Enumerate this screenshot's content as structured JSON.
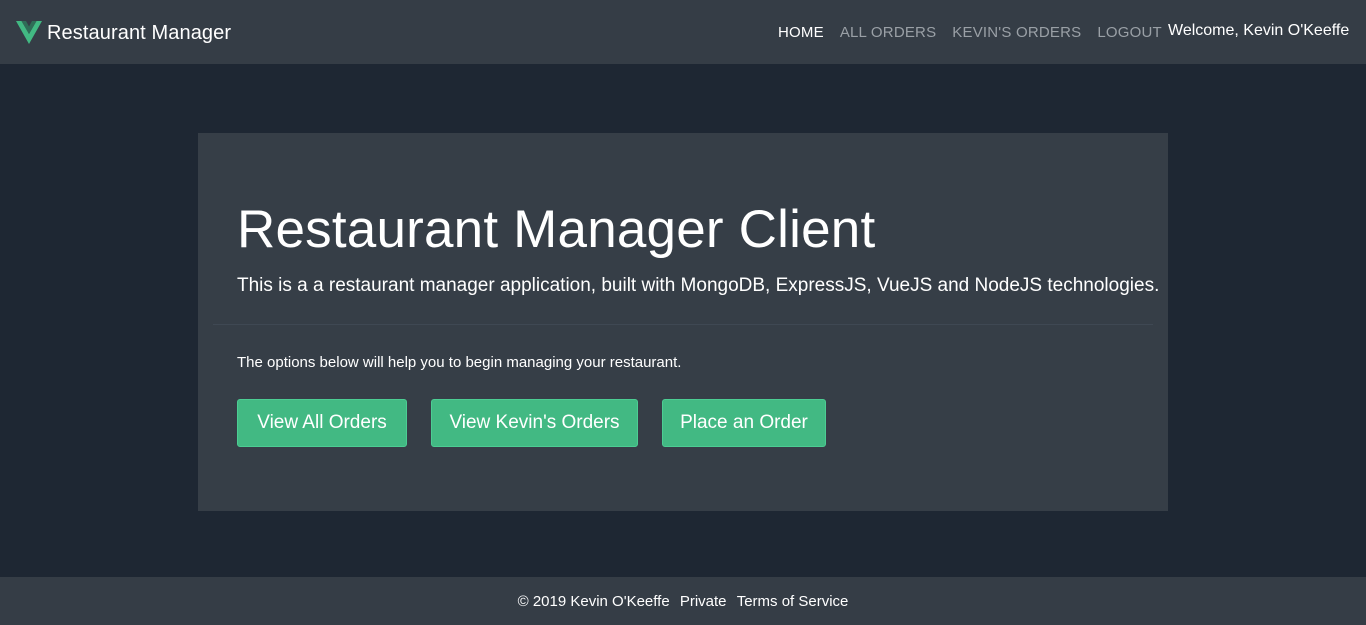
{
  "navbar": {
    "brand_logo_icon": "vue-logo-icon",
    "brand_label": "Restaurant Manager",
    "links": [
      {
        "label": "HOME",
        "active": true
      },
      {
        "label": "ALL ORDERS",
        "active": false
      },
      {
        "label": "KEVIN'S ORDERS",
        "active": false
      },
      {
        "label": "LOGOUT",
        "active": false
      }
    ],
    "welcome": "Welcome, Kevin O'Keeffe"
  },
  "main": {
    "title": "Restaurant Manager Client",
    "lead": "This is a a restaurant manager application, built with MongoDB, ExpressJS, VueJS and NodeJS technologies.",
    "intro": "The options below will help you to begin managing your restaurant.",
    "buttons": [
      {
        "label": "View All Orders"
      },
      {
        "label": "View Kevin's Orders"
      },
      {
        "label": "Place an Order"
      }
    ]
  },
  "footer": {
    "copyright": "© 2019 Kevin O'Keeffe",
    "private_label": "Private",
    "terms_label": "Terms of Service"
  },
  "colors": {
    "navbar_bg": "#353d46",
    "page_bg": "#1e2733",
    "jumbotron_bg": "#363e47",
    "accent_green": "#42b983"
  }
}
